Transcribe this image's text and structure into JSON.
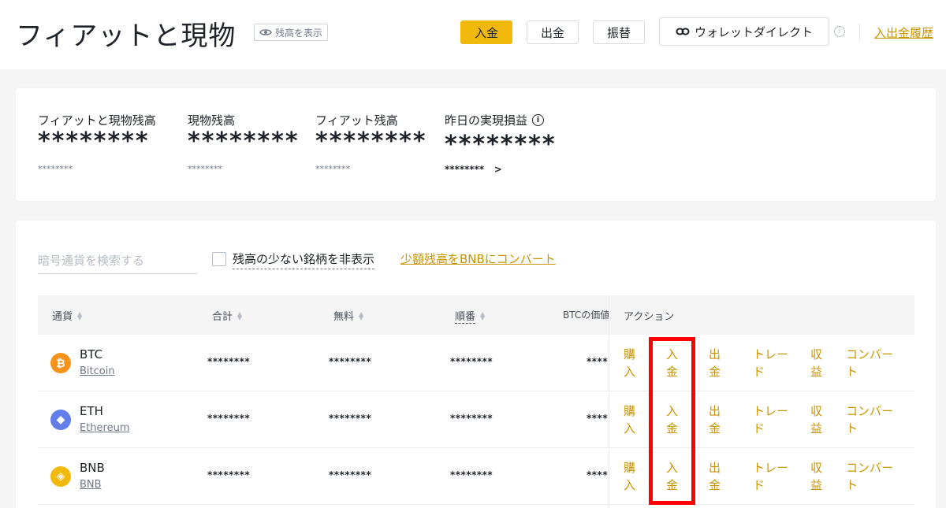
{
  "header": {
    "title": "フィアットと現物",
    "show_balance": "残高を表示",
    "buttons": {
      "deposit": "入金",
      "withdraw": "出金",
      "transfer": "振替",
      "wallet_direct": "ウォレットダイレクト"
    },
    "history_link": "入出金履歴"
  },
  "summary": {
    "items": [
      {
        "label": "フィアットと現物残高",
        "value": "********",
        "sub": "********"
      },
      {
        "label": "現物残高",
        "value": "********",
        "sub": "********"
      },
      {
        "label": "フィアット残高",
        "value": "********",
        "sub": "********"
      },
      {
        "label": "昨日の実現損益",
        "value": "********",
        "sub": "********",
        "sub_arrow": ">"
      }
    ]
  },
  "filters": {
    "search_placeholder": "暗号通貨を検索する",
    "hide_small": "残高の少ない銘柄を非表示",
    "convert_small": "少額残高をBNBにコンバート"
  },
  "table": {
    "headers": {
      "currency": "通貨",
      "total": "合計",
      "free": "無料",
      "order": "順番",
      "btc_value": "BTCの価値",
      "action": "アクション"
    },
    "rows": [
      {
        "symbol": "BTC",
        "name": "Bitcoin",
        "icon_color": "#f7931a",
        "icon": "bitcoin-icon",
        "total": "********",
        "free": "********",
        "order": "********",
        "btc_value": "****"
      },
      {
        "symbol": "ETH",
        "name": "Ethereum",
        "icon_color": "#627eea",
        "icon": "ethereum-icon",
        "total": "********",
        "free": "********",
        "order": "********",
        "btc_value": "****"
      },
      {
        "symbol": "BNB",
        "name": "BNB",
        "icon_color": "#f0b90b",
        "icon": "bnb-icon",
        "total": "********",
        "free": "********",
        "order": "********",
        "btc_value": "****"
      }
    ],
    "actions": [
      "購入",
      "入金",
      "出金",
      "トレード",
      "収益",
      "コンバート"
    ]
  },
  "colors": {
    "accent": "#f0b90b",
    "link": "#c99400",
    "highlight": "#ff0000"
  }
}
